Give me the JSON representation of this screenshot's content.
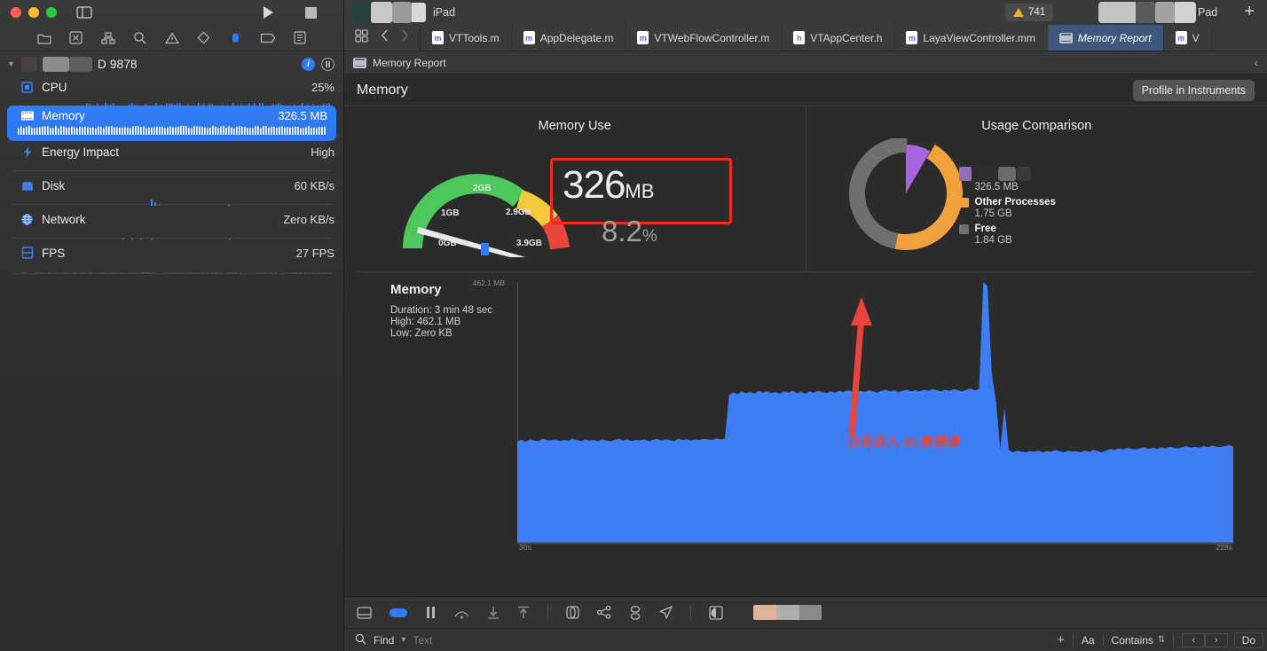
{
  "window": {
    "traffic_lights": [
      "close",
      "minimize",
      "zoom"
    ],
    "run_button": "run",
    "stop_button": "stop"
  },
  "navigator": {
    "toolbar_icons": [
      "folder-icon",
      "source-control-icon",
      "symbol-icon",
      "search-icon",
      "warning-icon",
      "test-icon",
      "debug-icon",
      "breakpoint-icon",
      "report-icon"
    ],
    "process": {
      "name_redacted": true,
      "name": "D 9878",
      "info_badge": "i",
      "pause_badge": "pause"
    },
    "gauges": [
      {
        "id": "cpu",
        "label": "CPU",
        "value": "25%",
        "icon": "cpu-icon",
        "selected": false
      },
      {
        "id": "memory",
        "label": "Memory",
        "value": "326.5 MB",
        "icon": "memory-icon",
        "selected": true
      },
      {
        "id": "energy",
        "label": "Energy Impact",
        "value": "High",
        "icon": "bolt-icon",
        "selected": false
      },
      {
        "id": "disk",
        "label": "Disk",
        "value": "60 KB/s",
        "icon": "disk-icon",
        "selected": false
      },
      {
        "id": "network",
        "label": "Network",
        "value": "Zero KB/s",
        "icon": "globe-icon",
        "selected": false
      },
      {
        "id": "fps",
        "label": "FPS",
        "value": "27 FPS",
        "icon": "fps-icon",
        "selected": false
      }
    ]
  },
  "titlebar": {
    "device_label": "iPad",
    "device_label_2": "Pad",
    "warning_count": "741",
    "add_button": "+"
  },
  "tabs": [
    {
      "label": "VTTools.m",
      "kind": "m",
      "active": false
    },
    {
      "label": "AppDelegate.m",
      "kind": "m",
      "active": false
    },
    {
      "label": "VTWebFlowController.m",
      "kind": "m",
      "active": false
    },
    {
      "label": "VTAppCenter.h",
      "kind": "h",
      "active": false
    },
    {
      "label": "LayaViewController.mm",
      "kind": "m",
      "active": false
    },
    {
      "label": "Memory Report",
      "kind": "report",
      "active": true
    },
    {
      "label": "V",
      "kind": "m",
      "active": false
    }
  ],
  "jumpbar": {
    "label": "Memory Report"
  },
  "report": {
    "title": "Memory",
    "profile_button": "Profile in Instruments"
  },
  "chart_data": [
    {
      "type": "gauge",
      "title": "Memory Use",
      "value": 326,
      "value_label": "326",
      "value_unit": "MB",
      "percent_label": "8.2",
      "percent_unit": "%",
      "ticks": [
        "0GB",
        "1GB",
        "2GB",
        "2.9GB",
        "3.9GB"
      ],
      "tick_values": [
        0,
        1,
        2,
        2.9,
        3.9
      ],
      "zones": [
        {
          "name": "green",
          "color": "#4cc95a",
          "from": 0,
          "to": 2.0
        },
        {
          "name": "yellow",
          "color": "#f5c93c",
          "from": 2.0,
          "to": 2.9
        },
        {
          "name": "red",
          "color": "#e8453c",
          "from": 2.9,
          "to": 3.9
        }
      ],
      "needle_value": 0.326,
      "highlight_box_color": "#f02b20"
    },
    {
      "type": "pie",
      "title": "Usage Comparison",
      "labels": [
        "",
        "Other Processes",
        "Free"
      ],
      "label_redacted": [
        true,
        false,
        false
      ],
      "values": [
        326.5,
        1750,
        1840
      ],
      "value_labels": [
        "326.5 MB",
        "1.75 GB",
        "1.84 GB"
      ],
      "colors": [
        "#a764dd",
        "#f0a03c",
        "#6f6f6f"
      ],
      "legend_position": "right"
    },
    {
      "type": "area",
      "title": "Memory",
      "subtitle_lines": [
        "Duration: 3 min 48 sec",
        "High: 462.1 MB",
        "Low: Zero KB"
      ],
      "ymax_label": "462.1 MB",
      "ymax": 462.1,
      "ymin": 0,
      "x_ticks": [
        "30s",
        "228s"
      ],
      "xlim": [
        30,
        228
      ],
      "series_color": "#3d7df6",
      "annotation": "点击进入 AI 录播课",
      "annotation_color": "#e8443a",
      "values": [
        180,
        182,
        179,
        183,
        181,
        180,
        184,
        182,
        181,
        183,
        180,
        182,
        181,
        184,
        182,
        180,
        183,
        181,
        182,
        180,
        183,
        181,
        180,
        182,
        184,
        181,
        183,
        180,
        182,
        181,
        183,
        180,
        182,
        184,
        181,
        183,
        182,
        180,
        184,
        182,
        183,
        181,
        183,
        182,
        184,
        183,
        182,
        185,
        183,
        184,
        262,
        266,
        263,
        268,
        265,
        267,
        264,
        269,
        266,
        268,
        265,
        267,
        264,
        268,
        266,
        269,
        265,
        267,
        264,
        268,
        266,
        269,
        267,
        265,
        268,
        266,
        269,
        267,
        270,
        268,
        266,
        269,
        267,
        270,
        268,
        266,
        269,
        271,
        268,
        270,
        267,
        269,
        271,
        268,
        270,
        268,
        271,
        269,
        272,
        270,
        268,
        271,
        269,
        272,
        270,
        268,
        271,
        273,
        270,
        272,
        462,
        455,
        300,
        250,
        166,
        240,
        164,
        160,
        163,
        161,
        160,
        162,
        161,
        163,
        160,
        162,
        161,
        164,
        162,
        160,
        163,
        161,
        162,
        160,
        163,
        161,
        164,
        162,
        160,
        163,
        166,
        164,
        167,
        165,
        168,
        166,
        165,
        167,
        169,
        166,
        168,
        166,
        169,
        167,
        170,
        168,
        167,
        169,
        171,
        168,
        170,
        168,
        171,
        169,
        172,
        170,
        169,
        171,
        173,
        170
      ]
    }
  ],
  "bottom_toolbar": {
    "icons": [
      "console-toggle-icon",
      "debug-area-icon",
      "pause-icon",
      "step-over-icon",
      "step-into-icon",
      "step-out-icon",
      "view-hierarchy-icon",
      "memory-graph-icon",
      "thread-icon",
      "location-icon",
      "appearance-icon"
    ],
    "filmstrip_colors": [
      "#dcb49a",
      "#adadad",
      "#8a8a8a"
    ]
  },
  "findbar": {
    "find_label": "Find",
    "dropdown": "v",
    "placeholder": "Text",
    "plus": "+",
    "match_case": "Aa",
    "match_mode": "Contains",
    "prev": "‹",
    "next": "›",
    "done": "Do"
  }
}
